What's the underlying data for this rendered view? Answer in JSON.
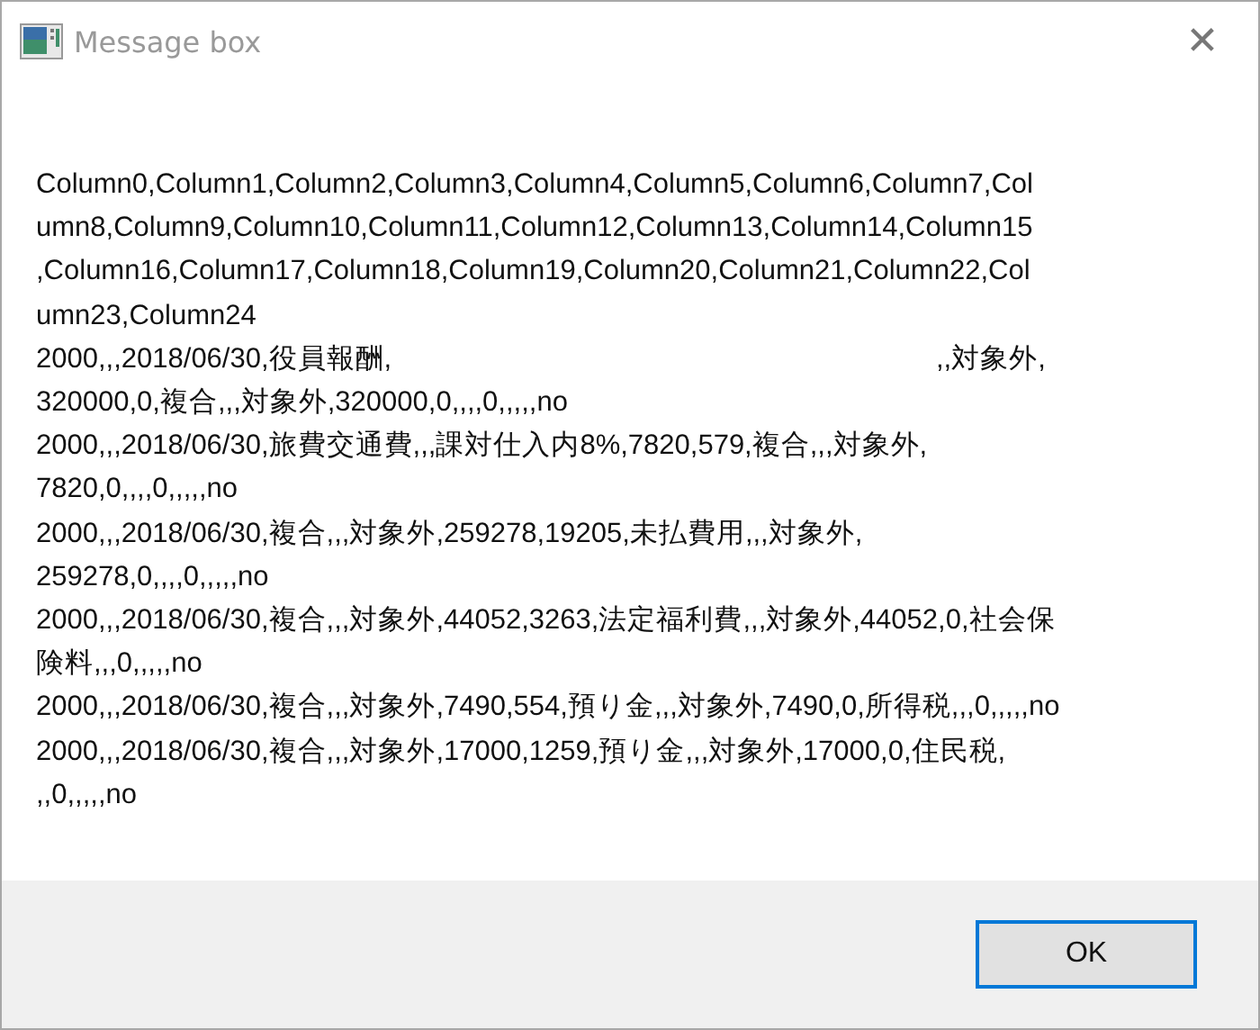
{
  "window": {
    "title": "Message box",
    "close": "✕"
  },
  "message_lines": [
    "Column0,Column1,Column2,Column3,Column4,Column5,Column6,Column7,Col",
    "umn8,Column9,Column10,Column11,Column12,Column13,Column14,Column15",
    ",Column16,Column17,Column18,Column19,Column20,Column21,Column22,Col",
    "umn23,Column24",
    "2000,,,2018/06/30,役員報酬,\t,,対象外,",
    "320000,0,複合,,,対象外,320000,0,,,,0,,,,,no",
    "2000,,,2018/06/30,旅費交通費,,,課対仕入内8%,7820,579,複合,,,対象外,",
    "7820,0,,,,0,,,,,no",
    "2000,,,2018/06/30,複合,,,対象外,259278,19205,未払費用,,,対象外,",
    "259278,0,,,,0,,,,,no",
    "2000,,,2018/06/30,複合,,,対象外,44052,3263,法定福利費,,,対象外,44052,0,社会保",
    "険料,,,0,,,,,no",
    "2000,,,2018/06/30,複合,,,対象外,7490,554,預り金,,,対象外,7490,0,所得税,,,0,,,,,no",
    "2000,,,2018/06/30,複合,,,対象外,17000,1259,預り金,,,対象外,17000,0,住民税,",
    ",,0,,,,,no"
  ],
  "buttons": [
    {
      "label": "OK",
      "selected": true
    }
  ]
}
